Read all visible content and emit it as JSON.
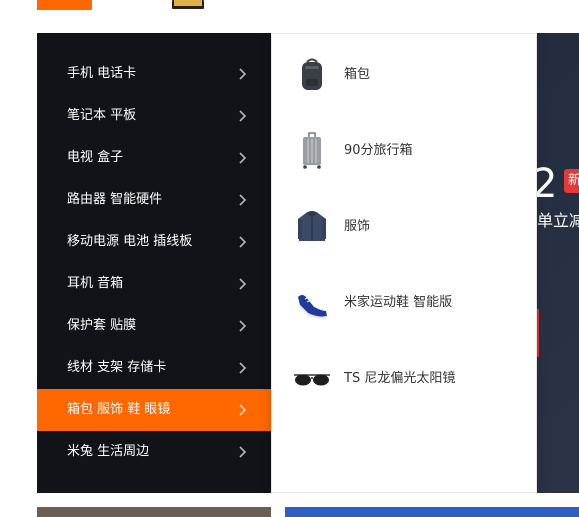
{
  "colors": {
    "accent": "#ff6700",
    "menu_bg": "#111319",
    "flyout_bg": "#ffffff",
    "text_dark": "#333333",
    "badge_red": "#e63a3a"
  },
  "banner": {
    "digit": "2",
    "tag": "新",
    "subtitle": "单立减"
  },
  "categories": [
    {
      "label": "手机 电话卡",
      "icon": "chevron-right-icon",
      "active": false
    },
    {
      "label": "笔记本 平板",
      "icon": "chevron-right-icon",
      "active": false
    },
    {
      "label": "电视 盒子",
      "icon": "chevron-right-icon",
      "active": false
    },
    {
      "label": "路由器 智能硬件",
      "icon": "chevron-right-icon",
      "active": false
    },
    {
      "label": "移动电源 电池 插线板",
      "icon": "chevron-right-icon",
      "active": false
    },
    {
      "label": "耳机 音箱",
      "icon": "chevron-right-icon",
      "active": false
    },
    {
      "label": "保护套 贴膜",
      "icon": "chevron-right-icon",
      "active": false
    },
    {
      "label": "线材 支架 存储卡",
      "icon": "chevron-right-icon",
      "active": false
    },
    {
      "label": "箱包 服饰 鞋 眼镜",
      "icon": "chevron-right-icon",
      "active": true
    },
    {
      "label": "米兔 生活周边",
      "icon": "chevron-right-icon",
      "active": false
    }
  ],
  "flyout": {
    "items": [
      {
        "label": "箱包",
        "thumb": "backpack-icon"
      },
      {
        "label": "90分旅行箱",
        "thumb": "suitcase-icon"
      },
      {
        "label": "服饰",
        "thumb": "jacket-icon"
      },
      {
        "label": "米家运动鞋 智能版",
        "thumb": "sneaker-icon"
      },
      {
        "label": "TS 尼龙偏光太阳镜",
        "thumb": "sunglasses-icon"
      }
    ]
  }
}
